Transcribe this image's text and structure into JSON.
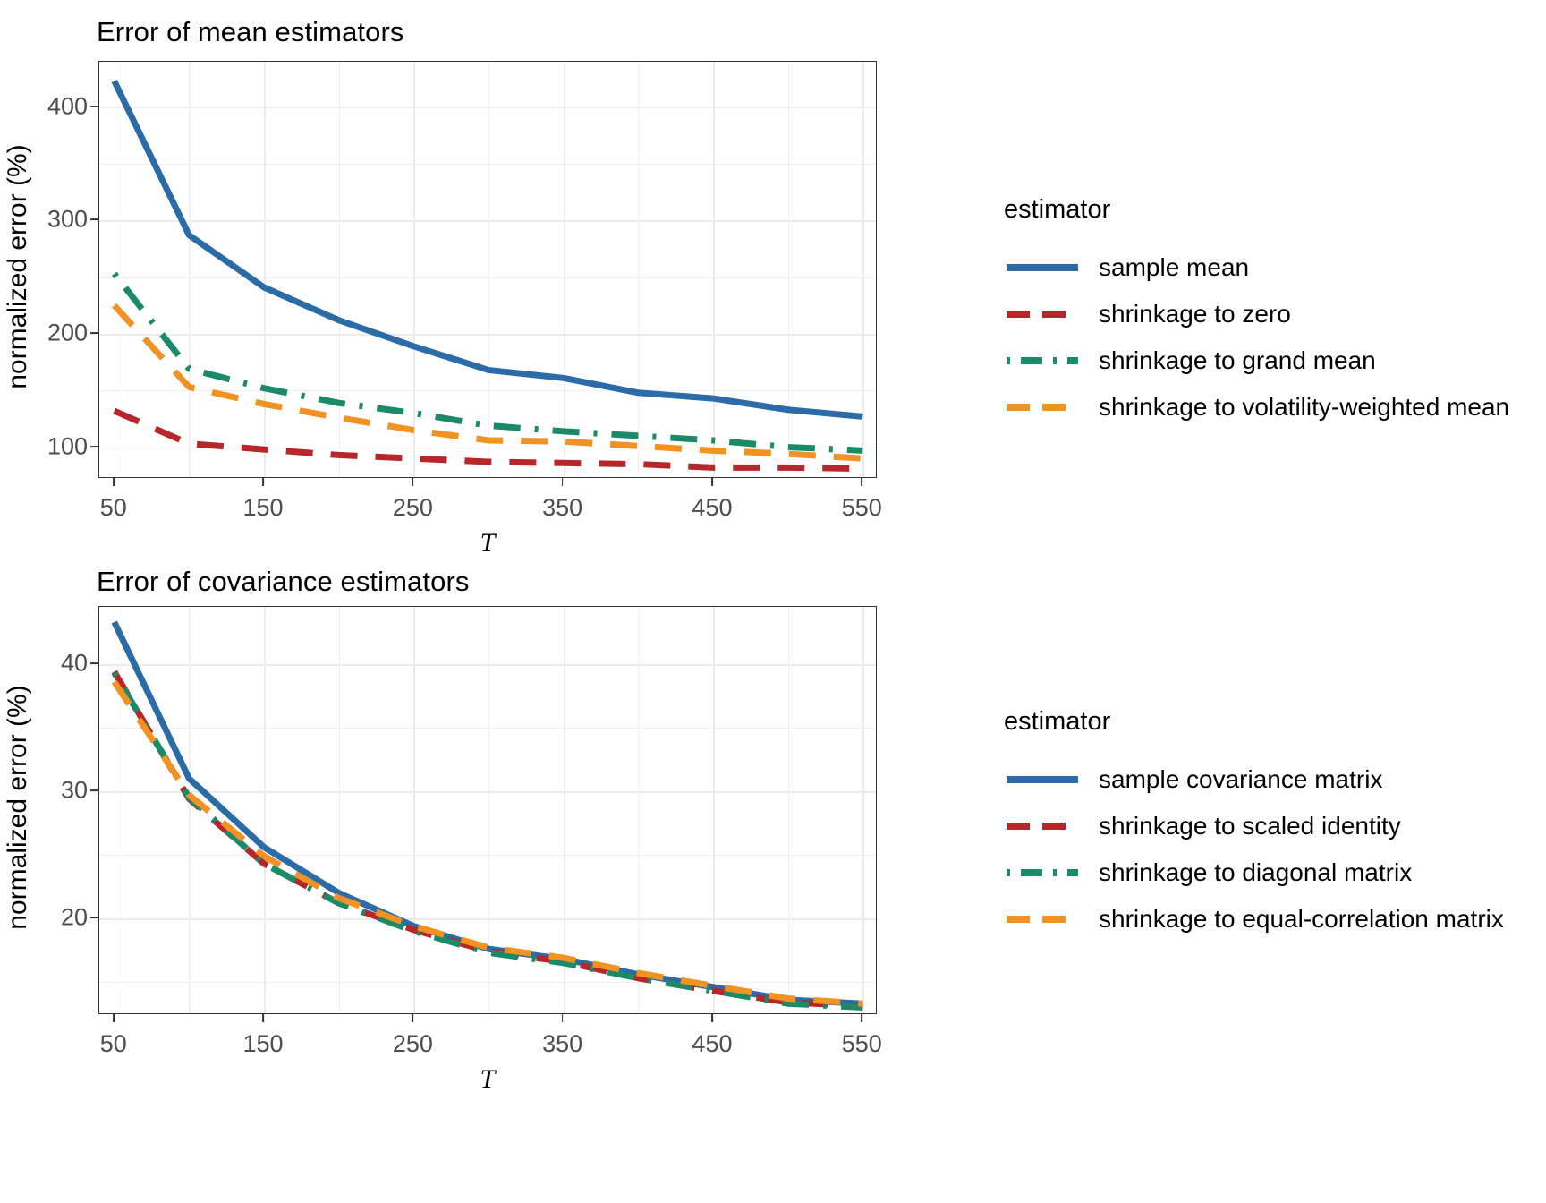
{
  "figure": {
    "background": "#ffffff",
    "palette": {
      "blue": "#2b6ca8",
      "red": "#b7262a",
      "green": "#1a8a68",
      "orange": "#f29222",
      "grid": "#ebebeb",
      "axis": "#333333",
      "tick_text": "#4d4d4d"
    }
  },
  "panels": [
    {
      "id": "mean",
      "title": "Error of mean estimators",
      "legend_title": "estimator",
      "xlabel": "T",
      "ylabel": "normalized error (%)"
    },
    {
      "id": "cov",
      "title": "Error of covariance estimators",
      "legend_title": "estimator",
      "xlabel": "T",
      "ylabel": "normalized error (%)"
    }
  ],
  "chart_data": [
    {
      "type": "line",
      "title": "Error of mean estimators",
      "xlabel": "T",
      "ylabel": "normalized error (%)",
      "legend_title": "estimator",
      "legend_position": "right",
      "grid": true,
      "xlim": [
        40,
        560
      ],
      "ylim": [
        72,
        440
      ],
      "xticks": [
        50,
        150,
        250,
        350,
        450,
        550
      ],
      "xticks_minor": [
        100,
        200,
        300,
        400,
        500
      ],
      "yticks": [
        100,
        200,
        300,
        400
      ],
      "yticks_minor": [
        150,
        250,
        350
      ],
      "x": [
        50,
        100,
        150,
        200,
        250,
        300,
        350,
        400,
        450,
        500,
        550
      ],
      "series": [
        {
          "name": "sample mean",
          "color": "#2b6ca8",
          "dash": "solid",
          "values": [
            423,
            287,
            241,
            212,
            189,
            168,
            161,
            148,
            143,
            133,
            127
          ]
        },
        {
          "name": "shrinkage to zero",
          "color": "#b7262a",
          "dash": "dashed",
          "values": [
            132,
            103,
            98,
            93,
            90,
            87,
            86,
            85,
            82,
            82,
            81
          ]
        },
        {
          "name": "shrinkage to grand mean",
          "color": "#1a8a68",
          "dash": "dashdot",
          "values": [
            253,
            169,
            152,
            139,
            130,
            119,
            114,
            110,
            106,
            100,
            97
          ]
        },
        {
          "name": "shrinkage to volatility-weighted mean",
          "color": "#f29222",
          "dash": "dashed",
          "values": [
            225,
            153,
            138,
            126,
            115,
            106,
            105,
            101,
            97,
            94,
            90
          ]
        }
      ]
    },
    {
      "type": "line",
      "title": "Error of covariance estimators",
      "xlabel": "T",
      "ylabel": "normalized error (%)",
      "legend_title": "estimator",
      "legend_position": "right",
      "grid": true,
      "xlim": [
        40,
        560
      ],
      "ylim": [
        12.4,
        44.5
      ],
      "xticks": [
        50,
        150,
        250,
        350,
        450,
        550
      ],
      "xticks_minor": [
        100,
        200,
        300,
        400,
        500
      ],
      "yticks": [
        20,
        30,
        40
      ],
      "yticks_minor": [
        15,
        25,
        35
      ],
      "x": [
        50,
        100,
        150,
        200,
        250,
        300,
        350,
        400,
        450,
        500,
        550
      ],
      "series": [
        {
          "name": "sample covariance matrix",
          "color": "#2b6ca8",
          "dash": "solid",
          "values": [
            43.3,
            31.0,
            25.6,
            22.0,
            19.4,
            17.6,
            16.8,
            15.6,
            14.6,
            13.6,
            13.3
          ]
        },
        {
          "name": "shrinkage to scaled identity",
          "color": "#b7262a",
          "dash": "dashed",
          "values": [
            39.4,
            29.4,
            24.3,
            21.2,
            19.1,
            17.4,
            16.6,
            15.3,
            14.3,
            13.4,
            13.1
          ]
        },
        {
          "name": "shrinkage to diagonal matrix",
          "color": "#1a8a68",
          "dash": "dashdot",
          "values": [
            39.3,
            29.5,
            24.3,
            21.2,
            19.0,
            17.3,
            16.5,
            15.3,
            14.3,
            13.3,
            13.0
          ]
        },
        {
          "name": "shrinkage to equal-correlation matrix",
          "color": "#f29222",
          "dash": "dashed",
          "values": [
            38.6,
            29.7,
            24.9,
            21.6,
            19.4,
            17.7,
            16.9,
            15.7,
            14.7,
            13.7,
            13.3
          ]
        }
      ]
    }
  ]
}
